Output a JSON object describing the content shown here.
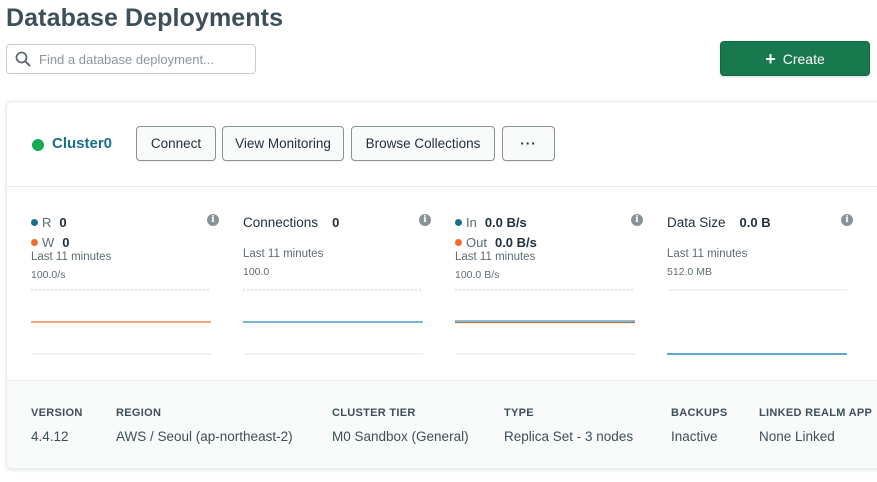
{
  "page": {
    "title": "Database Deployments"
  },
  "search": {
    "placeholder": "Find a database deployment..."
  },
  "create_button": {
    "label": "Create"
  },
  "cluster": {
    "name": "Cluster0",
    "status_color": "#13aa52",
    "buttons": {
      "connect": "Connect",
      "view_monitoring": "View Monitoring",
      "browse_collections": "Browse Collections",
      "more": "···"
    }
  },
  "metrics": {
    "ops": {
      "read_label": "R",
      "read_value": "0",
      "read_color": "#1a6f8e",
      "write_label": "W",
      "write_value": "0",
      "write_color": "#ef6c2a",
      "subtitle": "Last 11 minutes",
      "scale": "100.0/s"
    },
    "connections": {
      "title": "Connections",
      "value": "0",
      "subtitle": "Last 11 minutes",
      "scale": "100.0"
    },
    "network": {
      "in_label": "In",
      "in_value": "0.0 B/s",
      "out_label": "Out",
      "out_value": "0.0 B/s",
      "subtitle": "Last 11 minutes",
      "scale": "100.0 B/s"
    },
    "data_size": {
      "title": "Data Size",
      "value": "0.0 B",
      "subtitle": "Last 11 minutes",
      "scale": "512.0 MB"
    }
  },
  "details": [
    {
      "label": "VERSION",
      "value": "4.4.12"
    },
    {
      "label": "REGION",
      "value": "AWS / Seoul (ap-northeast-2)"
    },
    {
      "label": "CLUSTER TIER",
      "value": "M0 Sandbox (General)"
    },
    {
      "label": "TYPE",
      "value": "Replica Set - 3 nodes"
    },
    {
      "label": "BACKUPS",
      "value": "Inactive"
    },
    {
      "label": "LINKED REALM APP",
      "value": "None Linked"
    }
  ],
  "colors": {
    "accent_green": "#18794e",
    "series_blue": "#4a9bc9",
    "series_orange": "#ef8a4a"
  }
}
